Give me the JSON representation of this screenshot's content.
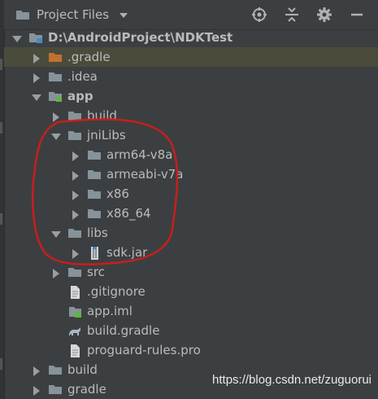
{
  "panel": {
    "title": "Project Files",
    "tools": [
      "locate-icon",
      "collapse-all-icon",
      "settings-icon",
      "minimize-icon"
    ]
  },
  "tree": [
    {
      "label": "D:\\AndroidProject\\NDKTest",
      "depth": 0,
      "expanded": true,
      "icon": "project-folder",
      "bold": true
    },
    {
      "label": ".gradle",
      "depth": 1,
      "expanded": false,
      "icon": "folder-orange",
      "selected": true
    },
    {
      "label": ".idea",
      "depth": 1,
      "expanded": false,
      "icon": "folder"
    },
    {
      "label": "app",
      "depth": 1,
      "expanded": true,
      "icon": "module-folder",
      "bold": true
    },
    {
      "label": "build",
      "depth": 2,
      "expanded": false,
      "icon": "folder"
    },
    {
      "label": "jniLibs",
      "depth": 2,
      "expanded": true,
      "icon": "folder"
    },
    {
      "label": "arm64-v8a",
      "depth": 3,
      "expanded": false,
      "icon": "folder"
    },
    {
      "label": "armeabi-v7a",
      "depth": 3,
      "expanded": false,
      "icon": "folder"
    },
    {
      "label": "x86",
      "depth": 3,
      "expanded": false,
      "icon": "folder"
    },
    {
      "label": "x86_64",
      "depth": 3,
      "expanded": false,
      "icon": "folder"
    },
    {
      "label": "libs",
      "depth": 2,
      "expanded": true,
      "icon": "folder"
    },
    {
      "label": "sdk.jar",
      "depth": 3,
      "expanded": false,
      "icon": "jar-file"
    },
    {
      "label": "src",
      "depth": 2,
      "expanded": false,
      "icon": "folder"
    },
    {
      "label": ".gitignore",
      "depth": 2,
      "icon": "text-file"
    },
    {
      "label": "app.iml",
      "depth": 2,
      "icon": "iml-file"
    },
    {
      "label": "build.gradle",
      "depth": 2,
      "icon": "gradle-file"
    },
    {
      "label": "proguard-rules.pro",
      "depth": 2,
      "icon": "text-file"
    },
    {
      "label": "build",
      "depth": 1,
      "expanded": false,
      "icon": "folder"
    },
    {
      "label": "gradle",
      "depth": 1,
      "expanded": false,
      "icon": "folder"
    }
  ],
  "watermark": "https://blog.csdn.net/zuguorui",
  "colors": {
    "background": "#3c3f41",
    "text": "#bbbbbb",
    "folder": "#87939a",
    "folder_orange": "#c0712f",
    "selection": "#4b4b3b",
    "annotation": "#c81e1e"
  }
}
